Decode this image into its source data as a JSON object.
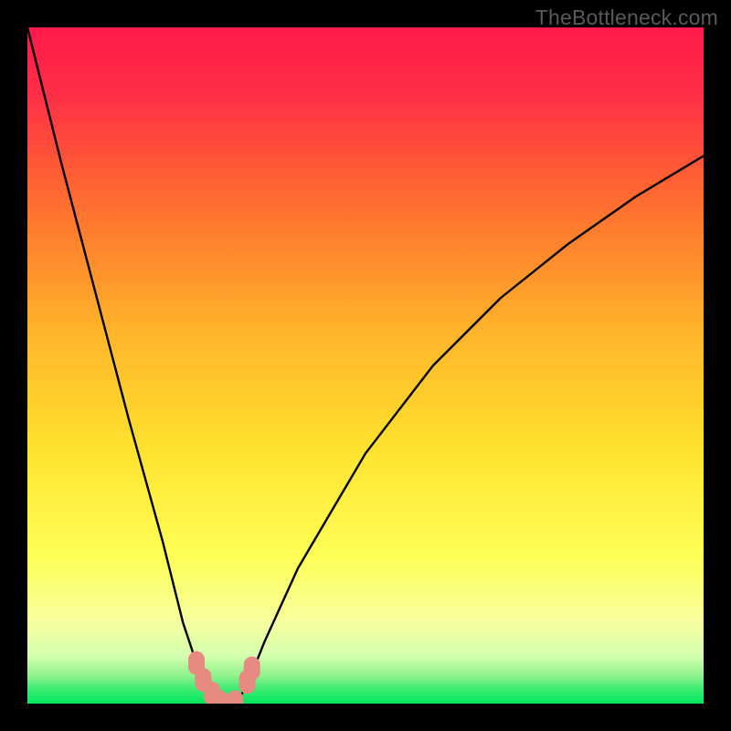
{
  "watermark": "TheBottleneck.com",
  "chart_data": {
    "type": "line",
    "title": "",
    "xlabel": "",
    "ylabel": "",
    "xlim": [
      0,
      100
    ],
    "ylim": [
      0,
      100
    ],
    "series": [
      {
        "name": "bottleneck-curve",
        "x": [
          0,
          5,
          10,
          15,
          20,
          23,
          25,
          27,
          28.5,
          30,
          31.5,
          33,
          35,
          40,
          50,
          60,
          70,
          80,
          90,
          100
        ],
        "values": [
          100,
          80,
          61,
          42,
          24,
          12,
          6,
          2,
          0,
          0,
          1,
          4,
          9,
          20,
          37,
          50,
          60,
          68,
          75,
          81
        ]
      }
    ],
    "markers": [
      {
        "x": 25.0,
        "y": 6.0
      },
      {
        "x": 26.0,
        "y": 3.5
      },
      {
        "x": 27.3,
        "y": 1.5
      },
      {
        "x": 28.5,
        "y": 0.2
      },
      {
        "x": 30.7,
        "y": 0.2
      },
      {
        "x": 32.5,
        "y": 3.2
      },
      {
        "x": 33.2,
        "y": 5.2
      }
    ],
    "gradient": {
      "top_color": "#ff1a4a",
      "mid_colors": [
        "#ff7b2e",
        "#ffd22c",
        "#ffff5a",
        "#f4ffb0"
      ],
      "bottom_color": "#00e85e"
    }
  }
}
